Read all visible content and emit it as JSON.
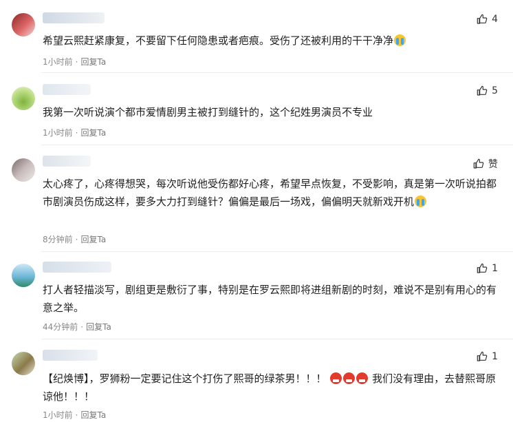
{
  "thumb_icon": "thumbs-up-icon",
  "comments": [
    {
      "likes": "4",
      "text": "希望云熙赶紧康复，不要留下任何隐患或者疤痕。受伤了还被利用的干干净净",
      "emoji": "loudly-crying-emoji",
      "time": "1小时前",
      "reply": "回复Ta"
    },
    {
      "likes": "5",
      "text": "我第一次听说演个都市爱情剧男主被打到缝针的，这个纪姓男演员不专业",
      "time": "1小时前",
      "reply": "回复Ta"
    },
    {
      "likes": "赞",
      "text": "太心疼了，心疼得想哭，每次听说他受伤都好心疼，希望早点恢复，不受影响，真是第一次听说拍都市剧演员伤成这样，要多大力打到缝针？偏偏是最后一场戏，偏偏明天就新戏开机",
      "emoji": "loudly-crying-emoji",
      "time": "8分钟前",
      "reply": "回复Ta"
    },
    {
      "likes": "1",
      "text": "打人者轻描淡写，剧组更是敷衍了事，特别是在罗云熙即将进组新剧的时刻，难说不是别有用心的有意之举。",
      "time": "44分钟前",
      "reply": "回复Ta"
    },
    {
      "likes": "1",
      "text_a": "【纪焕博】，罗狮粉一定要记住这个打伤了熙哥的绿茶男！！！",
      "emojis": [
        "angry-face-emoji",
        "angry-face-emoji",
        "angry-face-emoji"
      ],
      "text_b": "我们没有理由，去替熙哥原谅他！！！",
      "time": "1小时前",
      "reply": "回复Ta"
    }
  ]
}
